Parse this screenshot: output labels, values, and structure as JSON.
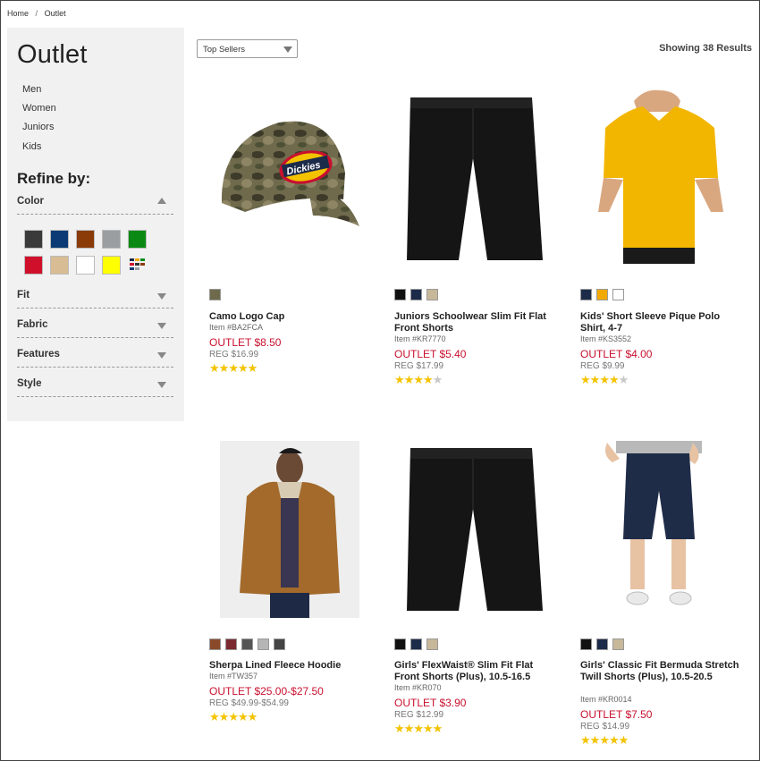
{
  "breadcrumb": {
    "home": "Home",
    "sep": "/",
    "current": "Outlet"
  },
  "sidebar": {
    "title": "Outlet",
    "categories": [
      "Men",
      "Women",
      "Juniors",
      "Kids"
    ],
    "refine_title": "Refine by:",
    "facets": {
      "color": "Color",
      "fit": "Fit",
      "fabric": "Fabric",
      "features": "Features",
      "style": "Style"
    },
    "color_swatches": [
      "#3a3a3a",
      "#0b3a75",
      "#8a3b08",
      "#9a9ea1",
      "#0a8a14",
      "#d0102b",
      "#d8bc93",
      "#ffffff",
      "#ffff00",
      "multi"
    ]
  },
  "toolbar": {
    "sort_selected": "Top Sellers",
    "results_text": "Showing 38 Results"
  },
  "products": [
    {
      "name": "Camo Logo Cap",
      "item": "Item #BA2FCA",
      "outlet": "OUTLET $8.50",
      "reg": "REG $16.99",
      "rating": 5,
      "swatches": [
        "camo"
      ]
    },
    {
      "name": "Juniors Schoolwear Slim Fit Flat Front Shorts",
      "item": "Item #KR7770",
      "outlet": "OUTLET $5.40",
      "reg": "REG $17.99",
      "rating": 4,
      "swatches": [
        "#111111",
        "#1c2b4a",
        "#c8b89a"
      ]
    },
    {
      "name": "Kids' Short Sleeve Pique Polo Shirt, 4-7",
      "item": "Item #KS3552",
      "outlet": "OUTLET $4.00",
      "reg": "REG $9.99",
      "rating": 4,
      "swatches": [
        "#1c2b4a",
        "#f2a900",
        "#ffffff"
      ]
    },
    {
      "name": "Sherpa Lined Fleece Hoodie",
      "item": "Item #TW357",
      "outlet": "OUTLET $25.00-$27.50",
      "reg": "REG $49.99-$54.99",
      "rating": 5,
      "swatches": [
        "#8a4a2a",
        "#7a2a30",
        "#555555",
        "#b5b5b5",
        "#444444"
      ]
    },
    {
      "name": "Girls' FlexWaist® Slim Fit Flat Front Shorts (Plus), 10.5-16.5",
      "item": "Item #KR070",
      "outlet": "OUTLET $3.90",
      "reg": "REG $12.99",
      "rating": 5,
      "swatches": [
        "#111111",
        "#1c2b4a",
        "#c8b89a"
      ]
    },
    {
      "name": "Girls' Classic Fit Bermuda Stretch Twill Shorts (Plus), 10.5-20.5",
      "item": "Item #KR0014",
      "outlet": "OUTLET $7.50",
      "reg": "REG $14.99",
      "rating": 5,
      "swatches": [
        "#111111",
        "#1c2b4a",
        "#c8b89a"
      ]
    }
  ]
}
